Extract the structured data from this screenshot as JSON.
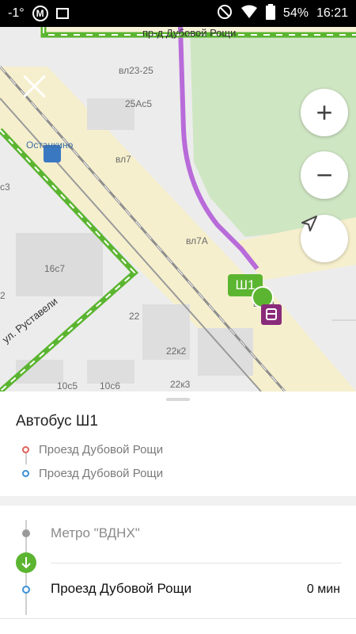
{
  "status_bar": {
    "signal": "-1°",
    "metro_letter": "М",
    "battery": "54%",
    "time": "16:21"
  },
  "map": {
    "labels": {
      "street_top": "пр-д Дубовой Рощи",
      "street_bottom": "ул. Руставели",
      "station": "Останкино",
      "b1": "вл23-25",
      "b2": "25Ас5",
      "b3": "вл7",
      "b4": "вл7А",
      "b5": "вл7А",
      "b6": "16с7",
      "b7": "с3",
      "b8": "2",
      "b9": "22",
      "b10": "22к2",
      "b11": "22к3",
      "b12": "10с5",
      "b13": "10с6"
    },
    "route_badge": "Ш1",
    "zoom_in_symbol": "+",
    "zoom_out_symbol": "−"
  },
  "sheet": {
    "title": "Автобус Ш1",
    "direction_from": "Проезд Дубовой Рощи",
    "direction_to": "Проезд Дубовой Рощи",
    "stops": [
      {
        "name": "Метро \"ВДНХ\"",
        "time": ""
      },
      {
        "name": "Проезд Дубовой Рощи",
        "time": "0 мин"
      }
    ]
  },
  "colors": {
    "route_green": "#5cb531",
    "route_purple": "#b86bd9",
    "bus_stop_purple": "#8a2b7a",
    "metro_blue": "#3b78c2"
  }
}
